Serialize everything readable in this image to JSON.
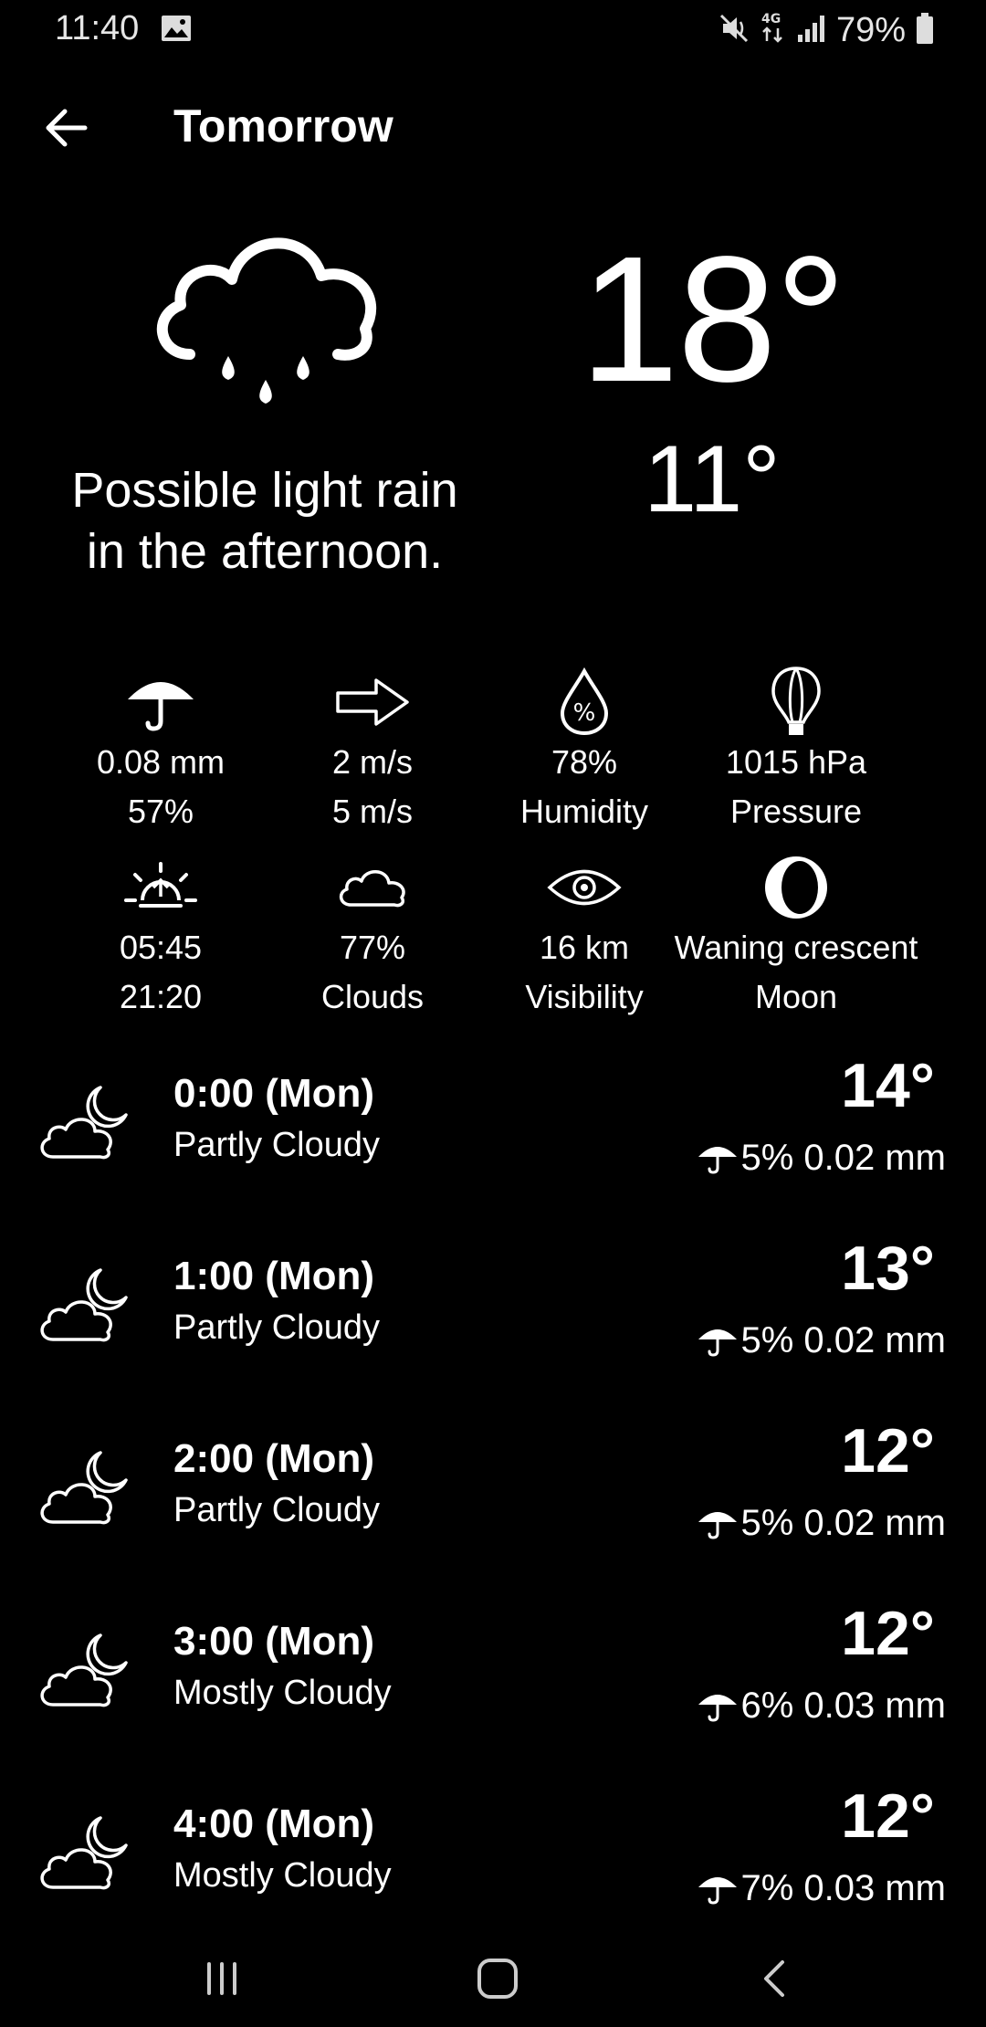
{
  "status_bar": {
    "time": "11:40",
    "battery": "79%",
    "icons": [
      "image-icon",
      "mute-icon",
      "4g-icon",
      "signal-icon",
      "battery-icon"
    ]
  },
  "header": {
    "title": "Tomorrow",
    "back_icon": "arrow-left-icon"
  },
  "today": {
    "icon": "cloud-rain-icon",
    "high": "18°",
    "low": "11°",
    "summary": "Possible light rain in the afternoon."
  },
  "details": [
    {
      "icon": "umbrella-icon",
      "line1": "0.08 mm",
      "line2": "57%"
    },
    {
      "icon": "wind-arrow-icon",
      "line1": "2 m/s",
      "line2": "5 m/s"
    },
    {
      "icon": "humidity-drop-icon",
      "line1": "78%",
      "line2": "Humidity"
    },
    {
      "icon": "balloon-icon",
      "line1": "1015 hPa",
      "line2": "Pressure"
    },
    {
      "icon": "sunrise-icon",
      "line1": "05:45",
      "line2": "21:20"
    },
    {
      "icon": "cloud-icon",
      "line1": "77%",
      "line2": "Clouds"
    },
    {
      "icon": "eye-icon",
      "line1": "16 km",
      "line2": "Visibility"
    },
    {
      "icon": "moon-phase-icon",
      "line1": "Waning crescent",
      "line2": "Moon"
    }
  ],
  "hours": [
    {
      "time": "0:00 (Mon)",
      "condition": "Partly Cloudy",
      "temp": "14°",
      "precip": "5% 0.02 mm",
      "icon": "cloud-moon-icon"
    },
    {
      "time": "1:00 (Mon)",
      "condition": "Partly Cloudy",
      "temp": "13°",
      "precip": "5% 0.02 mm",
      "icon": "cloud-moon-icon"
    },
    {
      "time": "2:00 (Mon)",
      "condition": "Partly Cloudy",
      "temp": "12°",
      "precip": "5% 0.02 mm",
      "icon": "cloud-moon-icon"
    },
    {
      "time": "3:00 (Mon)",
      "condition": "Mostly Cloudy",
      "temp": "12°",
      "precip": "6% 0.03 mm",
      "icon": "cloud-moon-icon"
    },
    {
      "time": "4:00 (Mon)",
      "condition": "Mostly Cloudy",
      "temp": "12°",
      "precip": "7% 0.03 mm",
      "icon": "cloud-moon-icon"
    }
  ],
  "nav": {
    "recents_icon": "recents-icon",
    "home_icon": "home-icon",
    "back_icon": "nav-back-icon"
  },
  "colors": {
    "background": "#000000",
    "foreground": "#ffffff"
  }
}
